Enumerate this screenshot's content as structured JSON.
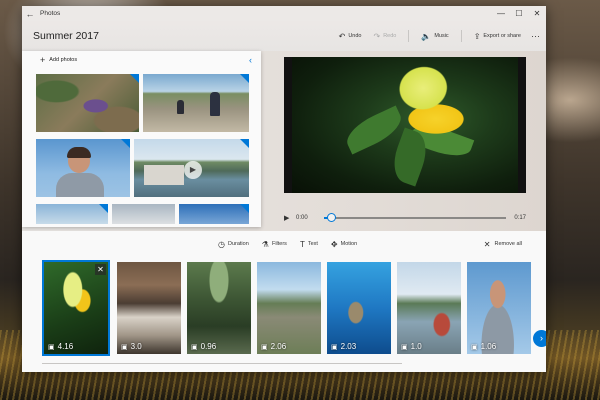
{
  "window": {
    "app_name": "Photos",
    "back_glyph": "←",
    "controls": {
      "minimize": "—",
      "maximize": "☐",
      "close": "✕"
    }
  },
  "header": {
    "project_title": "Summer 2017",
    "toolbar": {
      "undo": {
        "label": "Undo",
        "icon": "undo-icon",
        "glyph": "↶"
      },
      "redo": {
        "label": "Redo",
        "icon": "redo-icon",
        "glyph": "↷"
      },
      "music": {
        "label": "Music",
        "icon": "speaker-icon",
        "glyph": "🔈"
      },
      "export": {
        "label": "Export or share",
        "icon": "export-icon",
        "glyph": "⇪"
      },
      "more": "···"
    }
  },
  "library": {
    "add_photos": "Add photos",
    "plus_glyph": "+",
    "collapse_glyph": "‹",
    "play_glyph": "▶"
  },
  "player": {
    "play_glyph": "▶",
    "current_time": "0:00",
    "end_time": "0:17",
    "progress": 0.04
  },
  "storyboard": {
    "tools": [
      {
        "label": "Duration",
        "icon": "clock-icon",
        "glyph": "◷"
      },
      {
        "label": "Filters",
        "icon": "filters-icon",
        "glyph": "⚗"
      },
      {
        "label": "Text",
        "icon": "text-icon",
        "glyph": "T"
      },
      {
        "label": "Motion",
        "icon": "motion-icon",
        "glyph": "✥"
      }
    ],
    "remove_all": "Remove all",
    "remove_glyph": "✕",
    "close_glyph": "✕",
    "image_glyph": "▣",
    "next_glyph": "›",
    "cards": [
      {
        "duration": "4.16",
        "selected": true
      },
      {
        "duration": "3.0"
      },
      {
        "duration": "0.96"
      },
      {
        "duration": "2.06"
      },
      {
        "duration": "2.03"
      },
      {
        "duration": "1.0"
      },
      {
        "duration": "1.06"
      }
    ]
  },
  "colors": {
    "accent": "#0078d7",
    "window_bg": "#f2f1f0"
  }
}
